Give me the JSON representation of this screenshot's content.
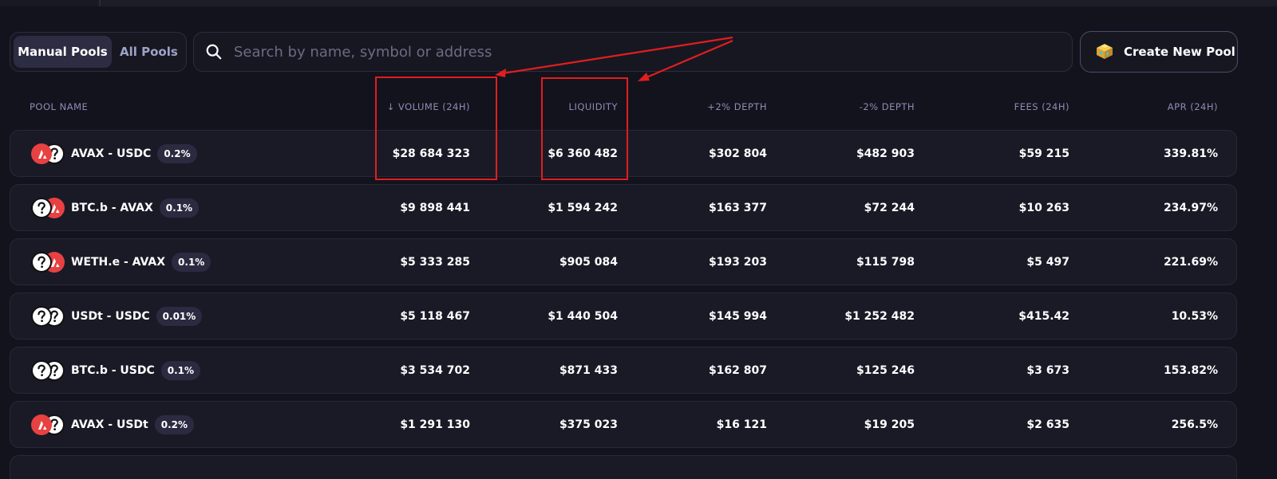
{
  "toggle": {
    "manual_label": "Manual Pools",
    "all_label": "All Pools"
  },
  "search": {
    "placeholder": "Search by name, symbol or address"
  },
  "create_button": {
    "label": "Create New Pool"
  },
  "columns": {
    "pool_name": "POOL NAME",
    "volume": "↓ VOLUME (24H)",
    "liquidity": "LIQUIDITY",
    "depth_plus": "+2% DEPTH",
    "depth_minus": "-2% DEPTH",
    "fees": "FEES (24H)",
    "apr": "APR (24H)"
  },
  "rows": [
    {
      "pair": "AVAX - USDC",
      "fee": "0.2%",
      "volume": "$28 684 323",
      "liquidity": "$6 360 482",
      "depth_plus": "$302 804",
      "depth_minus": "$482 903",
      "fees": "$59 215",
      "apr": "339.81%"
    },
    {
      "pair": "BTC.b - AVAX",
      "fee": "0.1%",
      "volume": "$9 898 441",
      "liquidity": "$1 594 242",
      "depth_plus": "$163 377",
      "depth_minus": "$72 244",
      "fees": "$10 263",
      "apr": "234.97%"
    },
    {
      "pair": "WETH.e - AVAX",
      "fee": "0.1%",
      "volume": "$5 333 285",
      "liquidity": "$905 084",
      "depth_plus": "$193 203",
      "depth_minus": "$115 798",
      "fees": "$5 497",
      "apr": "221.69%"
    },
    {
      "pair": "USDt - USDC",
      "fee": "0.01%",
      "volume": "$5 118 467",
      "liquidity": "$1 440 504",
      "depth_plus": "$145 994",
      "depth_minus": "$1 252 482",
      "fees": "$415.42",
      "apr": "10.53%"
    },
    {
      "pair": "BTC.b - USDC",
      "fee": "0.1%",
      "volume": "$3 534 702",
      "liquidity": "$871 433",
      "depth_plus": "$162 807",
      "depth_minus": "$125 246",
      "fees": "$3 673",
      "apr": "153.82%"
    },
    {
      "pair": "AVAX - USDt",
      "fee": "0.2%",
      "volume": "$1 291 130",
      "liquidity": "$375 023",
      "depth_plus": "$16 121",
      "depth_minus": "$19 205",
      "fees": "$2 635",
      "apr": "256.5%"
    }
  ],
  "icons": {
    "avax": "avax-token-icon",
    "unknown": "unknown-token-icon",
    "search": "search-icon",
    "pool": "pool-blocks-icon"
  },
  "colors": {
    "background": "#13131d",
    "row_bg": "#1a1a27",
    "header_text": "#8a8db5",
    "avax_red": "#e84142",
    "annotation_red": "#e11e1e"
  }
}
